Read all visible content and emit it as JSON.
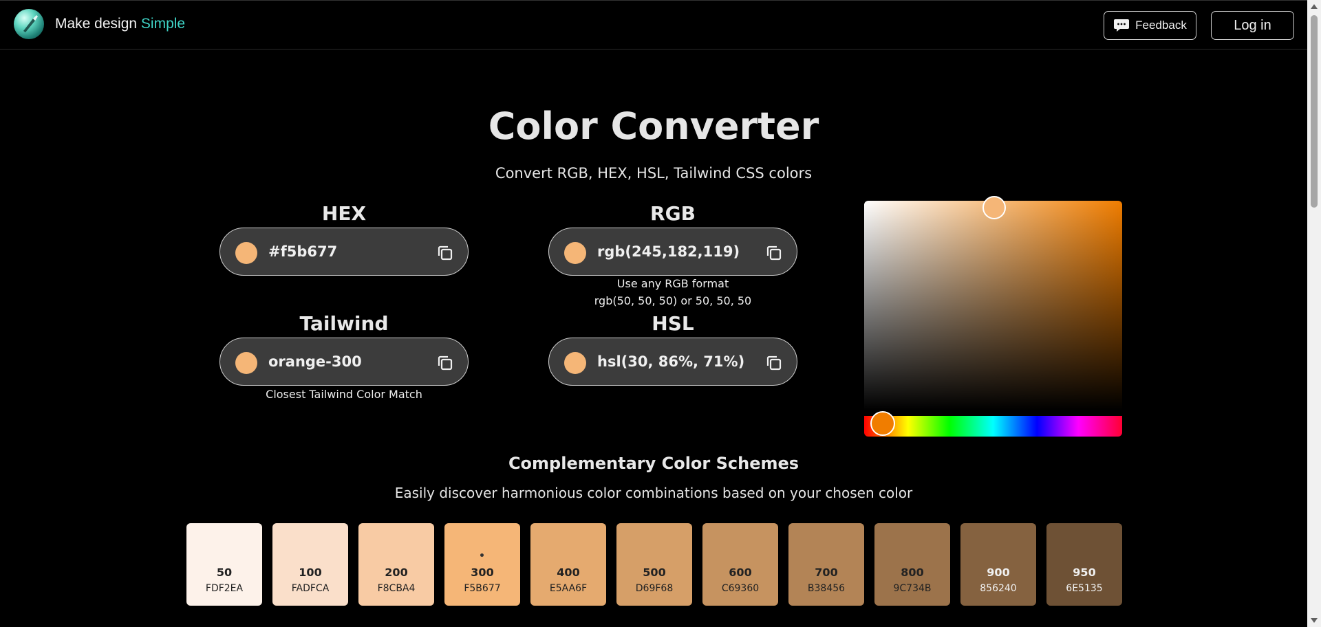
{
  "header": {
    "brand_main": "Make design",
    "brand_accent": "Simple",
    "feedback_label": "Feedback",
    "login_label": "Log in"
  },
  "page": {
    "title": "Color Converter",
    "subtitle": "Convert RGB, HEX, HSL, Tailwind CSS colors"
  },
  "fields": {
    "hex": {
      "label": "HEX",
      "value": "#f5b677"
    },
    "rgb": {
      "label": "RGB",
      "value": "rgb(245,182,119)",
      "hint_line1": "Use any RGB format",
      "hint_line2": "rgb(50, 50, 50) or 50, 50, 50"
    },
    "tailwind": {
      "label": "Tailwind",
      "value": "orange-300",
      "hint": "Closest Tailwind Color Match"
    },
    "hsl": {
      "label": "HSL",
      "value": "hsl(30, 86%, 71%)"
    }
  },
  "colors": {
    "selected": "#f5b677",
    "hue_base": "#f07d00",
    "brand_accent": "#3fd3c6"
  },
  "schemes": {
    "title": "Complementary Color Schemes",
    "subtitle": "Easily discover harmonious color combinations based on your chosen color",
    "shades": [
      {
        "shade": "50",
        "hex": "FDF2EA",
        "color": "#fdf2ea",
        "text": "#222222"
      },
      {
        "shade": "100",
        "hex": "FADFCA",
        "color": "#fadfca",
        "text": "#222222"
      },
      {
        "shade": "200",
        "hex": "F8CBA4",
        "color": "#f8cba4",
        "text": "#222222"
      },
      {
        "shade": "300",
        "hex": "F5B677",
        "color": "#f5b677",
        "text": "#222222",
        "selected": true
      },
      {
        "shade": "400",
        "hex": "E5AA6F",
        "color": "#e5aa6f",
        "text": "#222222"
      },
      {
        "shade": "500",
        "hex": "D69F68",
        "color": "#d69f68",
        "text": "#222222"
      },
      {
        "shade": "600",
        "hex": "C69360",
        "color": "#c69360",
        "text": "#222222"
      },
      {
        "shade": "700",
        "hex": "B38456",
        "color": "#b38456",
        "text": "#222222"
      },
      {
        "shade": "800",
        "hex": "9C734B",
        "color": "#9c734b",
        "text": "#222222"
      },
      {
        "shade": "900",
        "hex": "856240",
        "color": "#856240",
        "text": "#f0f0f0"
      },
      {
        "shade": "950",
        "hex": "6E5135",
        "color": "#6e5135",
        "text": "#f0f0f0"
      }
    ]
  }
}
